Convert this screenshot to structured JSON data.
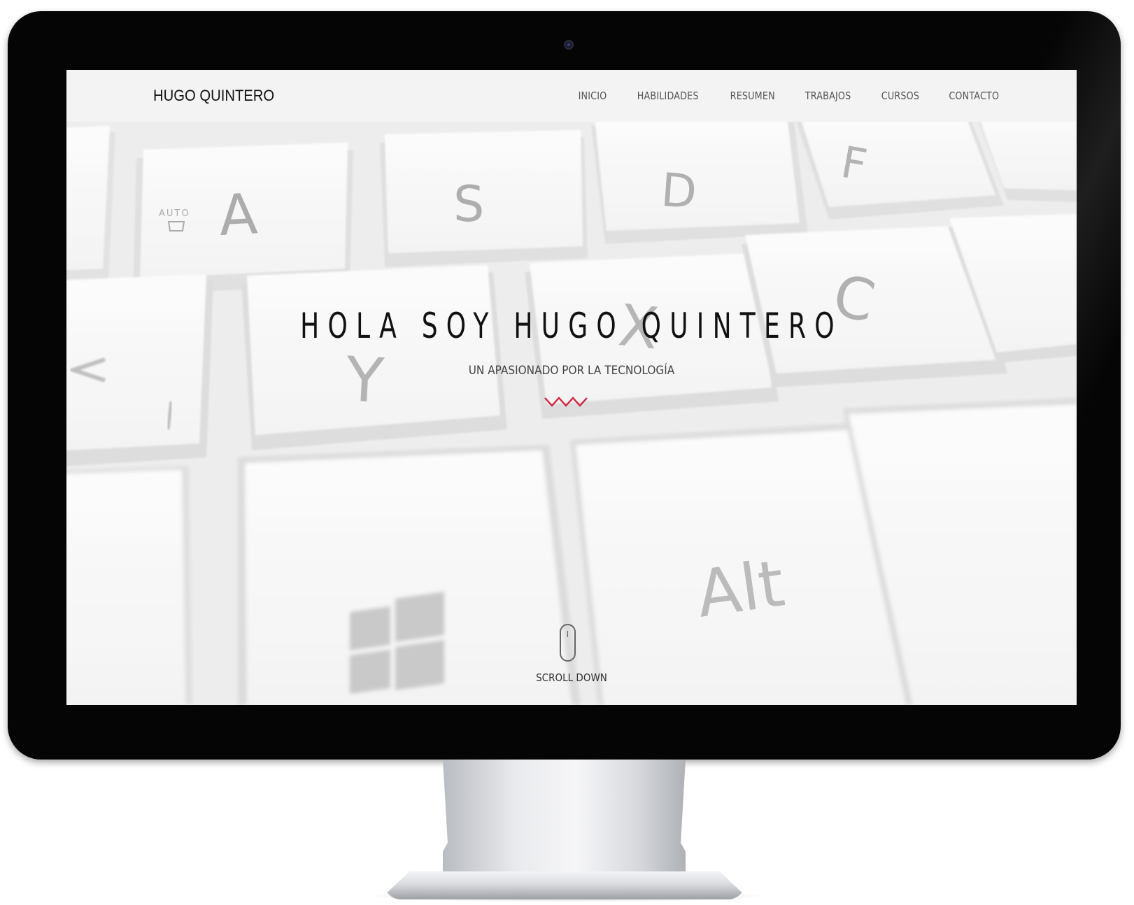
{
  "site": {
    "brand": "HUGO QUINTERO",
    "nav": [
      {
        "label": "INICIO"
      },
      {
        "label": "HABILIDADES"
      },
      {
        "label": "RESUMEN"
      },
      {
        "label": "TRABAJOS"
      },
      {
        "label": "CURSOS"
      },
      {
        "label": "CONTACTO"
      }
    ]
  },
  "hero": {
    "title": "HOLA SOY HUGO QUINTERO",
    "subtitle": "UN APASIONADO POR LA TECNOLOGÍA",
    "divider_icon": "zigzag-icon",
    "divider_color": "#d0243e",
    "scroll_icon": "mouse-icon",
    "scroll_label": "SCROLL DOWN",
    "background_keys": [
      "A",
      "S",
      "D",
      "F",
      "C",
      "X",
      "Y",
      "Alt",
      "AUTO"
    ]
  },
  "colors": {
    "frame": "#050505",
    "nav_background": "#f3f3f3",
    "accent": "#d0243e"
  }
}
